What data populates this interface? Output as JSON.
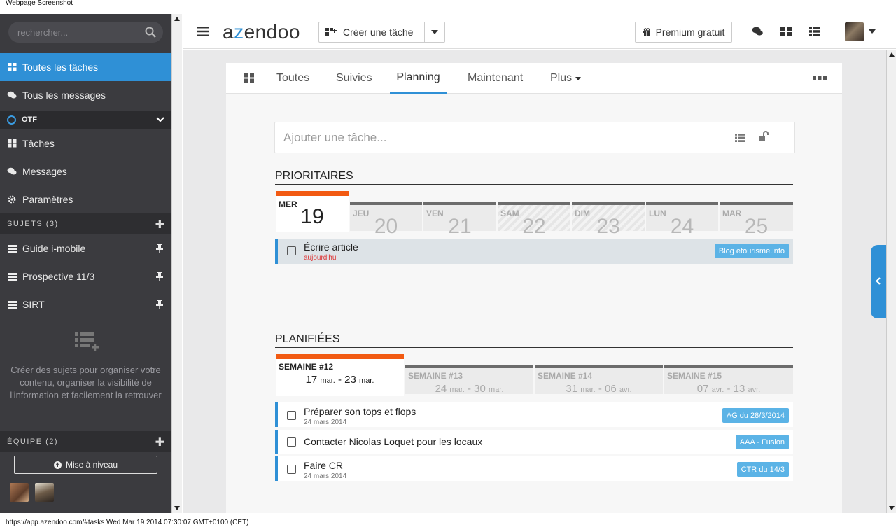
{
  "caption": "Webpage Screenshot",
  "footer_url": "https://app.azendoo.com/#tasks Wed Mar 19 2014 07:30:07 GMT+0100 (CET)",
  "sidebar": {
    "search_placeholder": "rechercher...",
    "nav": [
      {
        "label": "Toutes les tâches",
        "icon": "grid-icon",
        "active": true
      },
      {
        "label": "Tous les messages",
        "icon": "chat-icon",
        "active": false
      }
    ],
    "workspace": {
      "label": "OTF"
    },
    "workspace_items": [
      {
        "label": "Tâches",
        "icon": "grid-icon"
      },
      {
        "label": "Messages",
        "icon": "chat-icon"
      },
      {
        "label": "Paramètres",
        "icon": "gear-icon"
      }
    ],
    "subjects_header": "SUJETS (3)",
    "subjects": [
      {
        "label": "Guide i-mobile"
      },
      {
        "label": "Prospective 11/3"
      },
      {
        "label": "SIRT"
      }
    ],
    "empty_note": "Créer des sujets pour organiser votre contenu, organiser la visibilité de l'information et facilement la retrouver",
    "team_header": "ÉQUIPE (2)",
    "upgrade_label": "Mise à niveau"
  },
  "topbar": {
    "logo": {
      "a": "a",
      "z": "z",
      "rest": "endoo"
    },
    "create_label": "Créer une tâche",
    "premium_label": "Premium gratuit"
  },
  "tabs": [
    {
      "label": "Toutes"
    },
    {
      "label": "Suivies"
    },
    {
      "label": "Planning",
      "active": true
    },
    {
      "label": "Maintenant"
    },
    {
      "label": "Plus"
    }
  ],
  "add_task_placeholder": "Ajouter une tâche...",
  "prioritaires": {
    "title": "PRIORITAIRES",
    "days": [
      {
        "name": "MER",
        "num": "19"
      },
      {
        "name": "JEU",
        "num": "20"
      },
      {
        "name": "VEN",
        "num": "21"
      },
      {
        "name": "SAM",
        "num": "22"
      },
      {
        "name": "DIM",
        "num": "23"
      },
      {
        "name": "LUN",
        "num": "24"
      },
      {
        "name": "MAR",
        "num": "25"
      }
    ],
    "tasks": [
      {
        "title": "Écrire article",
        "sub": "aujourd'hui",
        "tag": "Blog etourisme.info"
      }
    ]
  },
  "planifiees": {
    "title": "PLANIFIÉES",
    "weeks": [
      {
        "name": "SEMAINE #12",
        "d1": "17",
        "m1": "mar.",
        "d2": "23",
        "m2": "mar."
      },
      {
        "name": "SEMAINE #13",
        "d1": "24",
        "m1": "mar.",
        "d2": "30",
        "m2": "mar."
      },
      {
        "name": "SEMAINE #14",
        "d1": "31",
        "m1": "mar.",
        "d2": "06",
        "m2": "avr."
      },
      {
        "name": "SEMAINE #15",
        "d1": "07",
        "m1": "avr.",
        "d2": "13",
        "m2": "avr."
      }
    ],
    "tasks": [
      {
        "title": "Préparer son tops et flops",
        "sub": "24 mars 2014",
        "tag": "AG du 28/3/2014"
      },
      {
        "title": "Contacter Nicolas Loquet pour les locaux",
        "sub": "",
        "tag": "AAA - Fusion"
      },
      {
        "title": "Faire CR",
        "sub": "24 mars 2014",
        "tag": "CTR du 14/3"
      }
    ]
  },
  "colors": {
    "accent": "#2f90d6",
    "today": "#f25a12",
    "sidebar": "#3b3b3f",
    "tag": "#5bb3e6"
  }
}
